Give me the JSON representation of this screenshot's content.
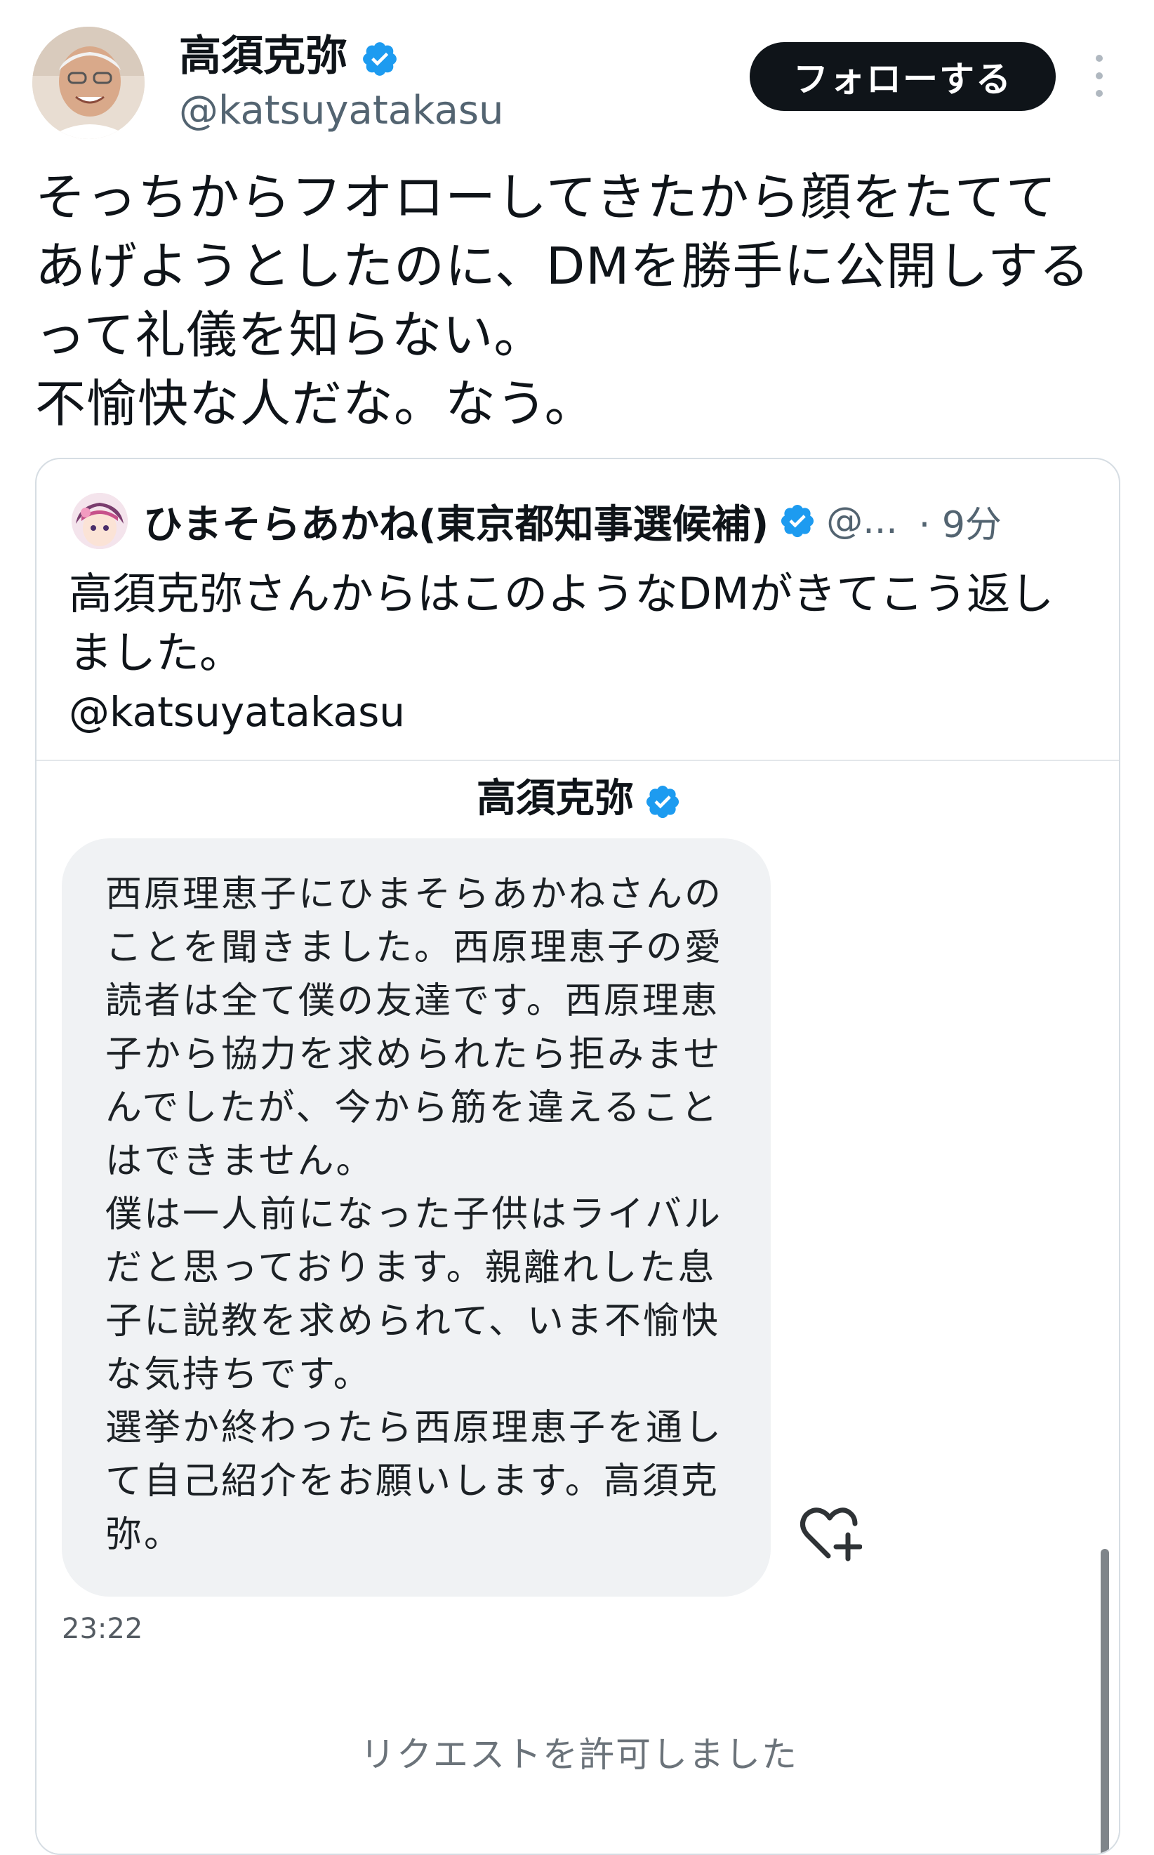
{
  "author": {
    "display_name": "高須克弥",
    "handle": "@katsuyatakasu",
    "verified": true
  },
  "follow_button_label": "フォローする",
  "tweet_text": "そっちからフオローしてきたから顔をたてて\nあげようとしたのに、DMを勝手に公開しする\nって礼儀を知らない。\n不愉快な人だな。なう。",
  "quote": {
    "display_name": "ひまそらあかね(東京都知事選候補)",
    "handle": "@...",
    "time": "· 9分",
    "text": "高須克弥さんからはこのようなDMがきてこう返し\nました。",
    "mention": "@katsuyatakasu",
    "dm": {
      "title": "高須克弥",
      "message": "西原理恵子にひまそらあかねさんの\nことを聞きました。西原理恵子の愛\n読者は全て僕の友達です。西原理恵\n子から協力を求められたら拒みませ\nんでしたが、今から筋を違えること\nはできません。\n僕は一人前になった子供はライバル\nだと思っております。親離れした息\n子に説教を求められて、いま不愉快\nな気持ちです。\n選挙か終わったら西原理恵子を通し\nて自己紹介をお願いします。高須克\n弥。",
      "timestamp": "23:22",
      "system_message": "リクエストを許可しました"
    }
  },
  "colors": {
    "verified_badge": "#1d9bf0",
    "follow_button_bg": "#0f1419",
    "secondary_text": "#536471",
    "dm_bubble_bg": "#f0f2f4"
  },
  "icons": {
    "verified": "verified-badge-icon",
    "more": "more-options-icon",
    "reaction": "heart-add-icon"
  }
}
